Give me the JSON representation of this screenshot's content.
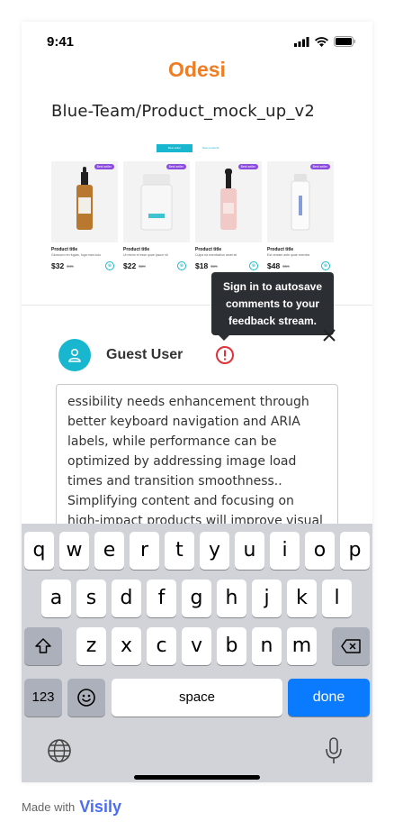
{
  "status_bar": {
    "time": "9:41"
  },
  "app": {
    "brand": "Odesi"
  },
  "document": {
    "title": "Blue-Team/Product_mock_up_v2"
  },
  "preview": {
    "tab_active": "Best seller",
    "tab_inactive": "New products",
    "products": [
      {
        "badge": "Best seller",
        "name": "Product title",
        "desc": "Glowsom ren fugias, fuga mea ludo",
        "price": "$32",
        "old_price": "$45"
      },
      {
        "badge": "Best seller",
        "name": "Product title",
        "desc": "Ut minim et esse quae ipsum sit",
        "price": "$22",
        "old_price": "$28"
      },
      {
        "badge": "Best seller",
        "name": "Product title",
        "desc": "Culpa ea exercitation amet sit",
        "price": "$18",
        "old_price": "$25"
      },
      {
        "badge": "Best seller",
        "name": "Product title",
        "desc": "Est veniam ante quae exercita",
        "price": "$48",
        "old_price": "$56"
      }
    ]
  },
  "tooltip": {
    "text_line1": "Sign in to autosave",
    "text_line2": "comments to your",
    "text_line3": "feedback stream."
  },
  "comment": {
    "user_name": "Guest User",
    "text": "essibility needs enhancement through better keyboard navigation and ARIA labels, while performance can be optimized by addressing image load times and transition smoothness.. Simplifying content and focusing on high-impact products will improve visual"
  },
  "keyboard": {
    "row1": [
      "q",
      "w",
      "e",
      "r",
      "t",
      "y",
      "u",
      "i",
      "o",
      "p"
    ],
    "row2": [
      "a",
      "s",
      "d",
      "f",
      "g",
      "h",
      "j",
      "k",
      "l"
    ],
    "row3": [
      "z",
      "x",
      "c",
      "v",
      "b",
      "n",
      "m"
    ],
    "numbers_label": "123",
    "space_label": "space",
    "done_label": "done"
  },
  "footer": {
    "made_with": "Made with",
    "logo": "Visily"
  },
  "colors": {
    "brand": "#f07d22",
    "accent": "#18b7cf",
    "tooltip_bg": "#2b2e33",
    "warning": "#e0313a",
    "done_key": "#0a7aff"
  }
}
